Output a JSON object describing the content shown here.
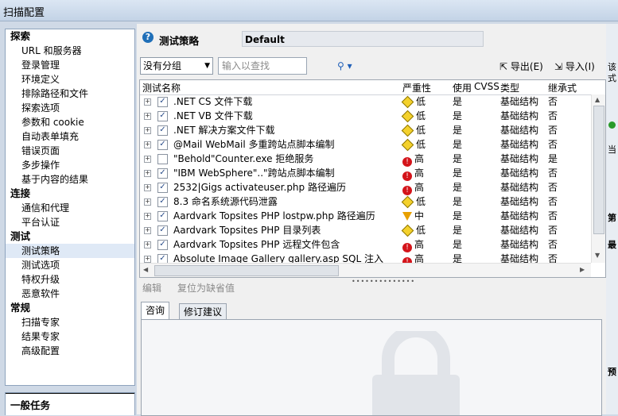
{
  "window": {
    "title": "扫描配置"
  },
  "sidebar": {
    "groups": [
      {
        "label": "探索",
        "items": [
          "URL 和服务器",
          "登录管理",
          "环境定义",
          "排除路径和文件",
          "探索选项",
          "参数和 cookie",
          "自动表单填充",
          "错误页面",
          "多步操作",
          "基于内容的结果"
        ]
      },
      {
        "label": "连接",
        "items": [
          "通信和代理",
          "平台认证"
        ]
      },
      {
        "label": "测试",
        "items": [
          "测试策略",
          "测试选项",
          "特权升级",
          "恶意软件"
        ]
      },
      {
        "label": "常规",
        "items": [
          "扫描专家",
          "结果专家",
          "高级配置"
        ]
      }
    ],
    "selected": "测试策略",
    "tasks_label": "一般任务"
  },
  "policy": {
    "title": "测试策略",
    "name": "Default"
  },
  "toolbar": {
    "group_select": "没有分组",
    "search_placeholder": "输入以查找",
    "export_label": "导出(E)",
    "import_label": "导入(I)"
  },
  "grid": {
    "columns": [
      "测试名称",
      "严重性",
      "使用",
      "CVSS",
      "类型",
      "继承式"
    ],
    "rows": [
      {
        "name": ".NET CS 文件下载",
        "severity": "低",
        "sev_icon": "low",
        "use": "是",
        "type": "基础结构",
        "inherit": "否"
      },
      {
        "name": ".NET VB 文件下载",
        "severity": "低",
        "sev_icon": "low",
        "use": "是",
        "type": "基础结构",
        "inherit": "否"
      },
      {
        "name": ".NET 解决方案文件下载",
        "severity": "低",
        "sev_icon": "low",
        "use": "是",
        "type": "基础结构",
        "inherit": "否"
      },
      {
        "name": "@Mail WebMail 多重跨站点脚本编制",
        "severity": "低",
        "sev_icon": "low",
        "use": "是",
        "type": "基础结构",
        "inherit": "否"
      },
      {
        "name": "\"Behold\"Counter.exe 拒绝服务",
        "severity": "高",
        "sev_icon": "high",
        "use": "是",
        "type": "基础结构",
        "inherit": "是"
      },
      {
        "name": "\"IBM WebSphere\"..\"跨站点脚本编制",
        "severity": "高",
        "sev_icon": "high",
        "use": "是",
        "type": "基础结构",
        "inherit": "否"
      },
      {
        "name": "2532|Gigs activateuser.php 路径遍历",
        "severity": "高",
        "sev_icon": "high",
        "use": "是",
        "type": "基础结构",
        "inherit": "否"
      },
      {
        "name": "8.3 命名系统源代码泄露",
        "severity": "低",
        "sev_icon": "low",
        "use": "是",
        "type": "基础结构",
        "inherit": "否"
      },
      {
        "name": "Aardvark Topsites PHP lostpw.php 路径遍历",
        "severity": "中",
        "sev_icon": "mid",
        "use": "是",
        "type": "基础结构",
        "inherit": "否"
      },
      {
        "name": "Aardvark Topsites PHP 目录列表",
        "severity": "低",
        "sev_icon": "low",
        "use": "是",
        "type": "基础结构",
        "inherit": "否"
      },
      {
        "name": "Aardvark Topsites PHP 远程文件包含",
        "severity": "高",
        "sev_icon": "high",
        "use": "是",
        "type": "基础结构",
        "inherit": "否"
      },
      {
        "name": "Absolute Image Gallery gallery.asp SQL 注入",
        "severity": "高",
        "sev_icon": "high",
        "use": "是",
        "type": "基础结构",
        "inherit": "否"
      }
    ]
  },
  "actions": {
    "edit": "编辑",
    "reset": "复位为缺省值"
  },
  "detail_tabs": [
    "咨询",
    "修订建议"
  ],
  "right_pane": {
    "text1": "该",
    "text2": "式",
    "text3": "当",
    "text4": "第",
    "text5": "最",
    "text6": "预"
  }
}
